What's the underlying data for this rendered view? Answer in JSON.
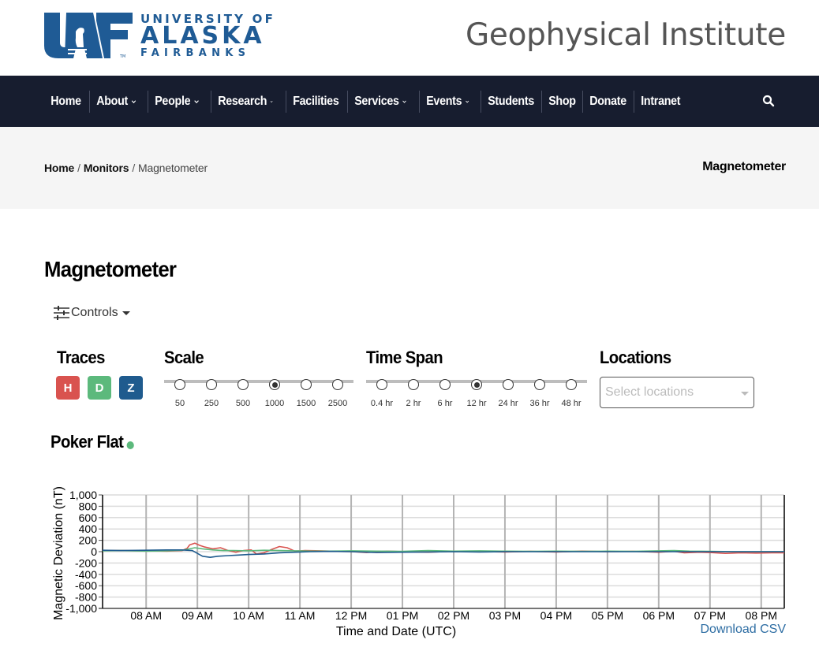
{
  "header": {
    "logo": {
      "mark": "UAF",
      "line1": "UNIVERSITY OF",
      "line2": "ALASKA",
      "line3": "FAIRBANKS",
      "color": "#1f5b95"
    },
    "site_title": "Geophysical Institute"
  },
  "nav": {
    "items": [
      {
        "label": "Home",
        "has_dropdown": false
      },
      {
        "label": "About",
        "has_dropdown": true
      },
      {
        "label": "People",
        "has_dropdown": true
      },
      {
        "label": "Research",
        "has_dropdown": true
      },
      {
        "label": "Facilities",
        "has_dropdown": false
      },
      {
        "label": "Services",
        "has_dropdown": true
      },
      {
        "label": "Events",
        "has_dropdown": true
      },
      {
        "label": "Students",
        "has_dropdown": false
      },
      {
        "label": "Shop",
        "has_dropdown": false
      },
      {
        "label": "Donate",
        "has_dropdown": false
      },
      {
        "label": "Intranet",
        "has_dropdown": false
      }
    ],
    "search_icon": "search-icon",
    "background": "#171d2f"
  },
  "breadcrumb": {
    "items": [
      {
        "label": "Home",
        "link": true
      },
      {
        "label": "Monitors",
        "link": true
      },
      {
        "label": "Magnetometer",
        "link": false
      }
    ],
    "separator": "/",
    "page_label": "Magnetometer"
  },
  "main": {
    "title": "Magnetometer",
    "controls_label": "Controls",
    "sections": {
      "traces": "Traces",
      "scale": "Scale",
      "time_span": "Time Span",
      "locations": "Locations"
    },
    "traces": [
      {
        "label": "H",
        "color": "#d9534f"
      },
      {
        "label": "D",
        "color": "#5cb97c"
      },
      {
        "label": "Z",
        "color": "#1f5b8e"
      }
    ],
    "scale_options": [
      "50",
      "250",
      "500",
      "1000",
      "1500",
      "2500"
    ],
    "scale_selected": "1000",
    "time_span_options": [
      "0.4 hr",
      "2 hr",
      "6 hr",
      "12 hr",
      "24 hr",
      "36 hr",
      "48 hr"
    ],
    "time_span_selected": "12 hr",
    "locations_placeholder": "Select locations",
    "station": {
      "name": "Poker Flat",
      "status_color": "#5cb97c"
    },
    "download_label": "Download CSV"
  },
  "chart_data": {
    "type": "line",
    "title": "",
    "xlabel": "Time and Date (UTC)",
    "ylabel": "Magnetic Deviation (nT)",
    "ylim": [
      -1000,
      1000
    ],
    "yticks": [
      "1,000",
      "800",
      "600",
      "400",
      "200",
      "0",
      "-200",
      "-400",
      "-600",
      "-800",
      "-1,000"
    ],
    "ytick_values": [
      1000,
      800,
      600,
      400,
      200,
      0,
      -200,
      -400,
      -600,
      -800,
      -1000
    ],
    "xlim_hours": [
      7.15,
      20.45
    ],
    "xticks": [
      "08 AM",
      "09 AM",
      "10 AM",
      "11 AM",
      "12 PM",
      "01 PM",
      "02 PM",
      "03 PM",
      "04 PM",
      "05 PM",
      "06 PM",
      "07 PM",
      "08 PM"
    ],
    "xtick_hours": [
      8,
      9,
      10,
      11,
      12,
      13,
      14,
      15,
      16,
      17,
      18,
      19,
      20
    ],
    "grid": true,
    "series": [
      {
        "name": "H",
        "color": "#d9534f",
        "x": [
          7.15,
          7.5,
          8.0,
          8.4,
          8.7,
          8.8,
          8.85,
          8.95,
          9.05,
          9.15,
          9.3,
          9.45,
          9.6,
          9.75,
          9.9,
          10.05,
          10.15,
          10.3,
          10.45,
          10.6,
          10.75,
          10.9,
          11.1,
          11.4,
          11.7,
          12.0,
          12.3,
          12.7,
          13.0,
          13.5,
          14.0,
          14.5,
          15.0,
          15.5,
          16.0,
          16.5,
          17.0,
          17.5,
          18.0,
          18.3,
          18.5,
          18.8,
          19.0,
          19.3,
          19.6,
          19.9,
          20.2,
          20.45
        ],
        "values": [
          20,
          20,
          15,
          10,
          20,
          60,
          120,
          150,
          110,
          80,
          50,
          70,
          20,
          -10,
          20,
          30,
          -40,
          -20,
          40,
          90,
          70,
          10,
          20,
          15,
          5,
          0,
          -15,
          10,
          0,
          -10,
          5,
          0,
          -5,
          5,
          -5,
          10,
          0,
          5,
          -10,
          5,
          -20,
          -10,
          -15,
          -30,
          -20,
          -25,
          -20,
          -20
        ]
      },
      {
        "name": "D",
        "color": "#5cb97c",
        "x": [
          7.15,
          7.5,
          8.0,
          8.4,
          8.7,
          8.85,
          8.95,
          9.1,
          9.3,
          9.5,
          9.7,
          10.0,
          10.3,
          10.6,
          10.9,
          11.2,
          11.6,
          12.0,
          12.5,
          13.0,
          13.5,
          14.0,
          14.5,
          15.0,
          15.5,
          16.0,
          16.5,
          17.0,
          17.5,
          18.0,
          18.3,
          18.6,
          19.0,
          19.5,
          20.0,
          20.45
        ],
        "values": [
          15,
          20,
          10,
          15,
          25,
          50,
          70,
          50,
          30,
          20,
          20,
          15,
          25,
          20,
          15,
          10,
          10,
          15,
          10,
          5,
          20,
          10,
          15,
          10,
          5,
          10,
          5,
          10,
          5,
          15,
          20,
          10,
          5,
          0,
          0,
          0
        ]
      },
      {
        "name": "Z",
        "color": "#1f5b8e",
        "x": [
          7.15,
          7.5,
          8.0,
          8.4,
          8.7,
          8.9,
          9.0,
          9.1,
          9.25,
          9.4,
          9.6,
          9.8,
          10.0,
          10.3,
          10.6,
          10.9,
          11.2,
          11.6,
          12.0,
          12.5,
          13.0,
          13.5,
          14.0,
          14.5,
          15.0,
          15.5,
          16.0,
          16.5,
          17.0,
          17.5,
          18.0,
          18.5,
          19.0,
          19.5,
          20.0,
          20.45
        ],
        "values": [
          25,
          20,
          25,
          30,
          30,
          20,
          -30,
          -80,
          -100,
          -80,
          -70,
          -60,
          -50,
          -40,
          -20,
          -10,
          0,
          5,
          0,
          -15,
          -10,
          -5,
          0,
          -5,
          0,
          0,
          0,
          0,
          0,
          0,
          0,
          0,
          0,
          0,
          0,
          0
        ]
      }
    ]
  }
}
